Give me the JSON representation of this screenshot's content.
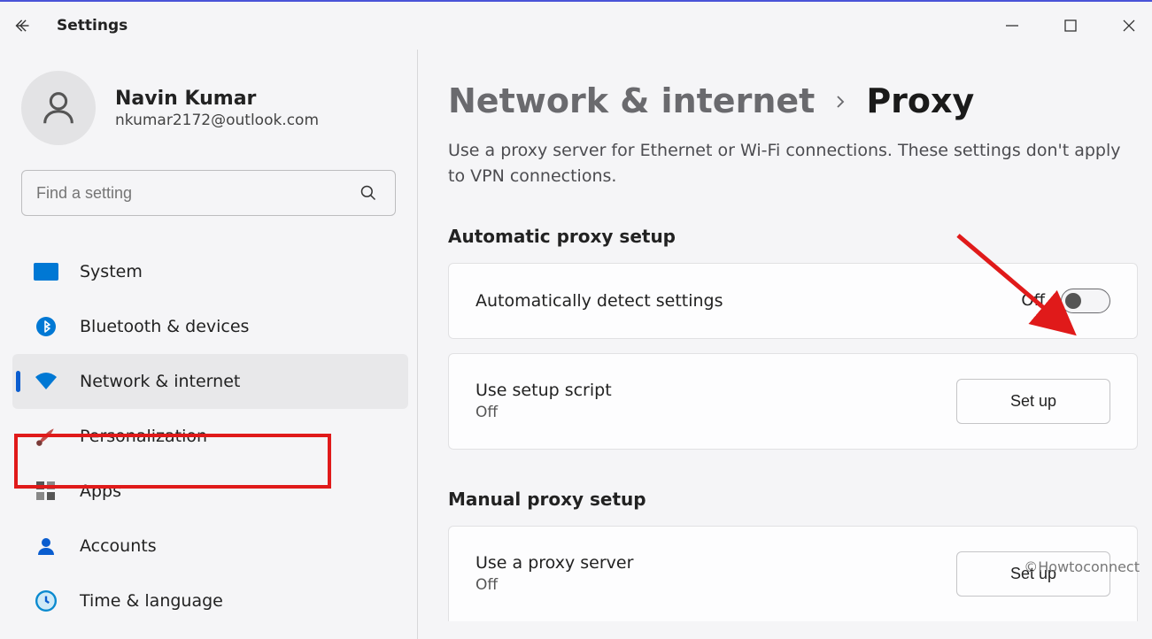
{
  "app": {
    "title": "Settings"
  },
  "user": {
    "name": "Navin Kumar",
    "email": "nkumar2172@outlook.com"
  },
  "search": {
    "placeholder": "Find a setting"
  },
  "sidebar": {
    "items": [
      {
        "label": "System"
      },
      {
        "label": "Bluetooth & devices"
      },
      {
        "label": "Network & internet"
      },
      {
        "label": "Personalization"
      },
      {
        "label": "Apps"
      },
      {
        "label": "Accounts"
      },
      {
        "label": "Time & language"
      }
    ]
  },
  "breadcrumb": {
    "parent": "Network & internet",
    "current": "Proxy"
  },
  "description": "Use a proxy server for Ethernet or Wi-Fi connections. These settings don't apply to VPN connections.",
  "sections": {
    "auto": {
      "title": "Automatic proxy setup",
      "detect": {
        "label": "Automatically detect settings",
        "state": "Off"
      },
      "script": {
        "label": "Use setup script",
        "state": "Off",
        "button": "Set up"
      }
    },
    "manual": {
      "title": "Manual proxy setup",
      "server": {
        "label": "Use a proxy server",
        "state": "Off",
        "button": "Set up"
      }
    }
  },
  "watermark": "©Howtoconnect"
}
